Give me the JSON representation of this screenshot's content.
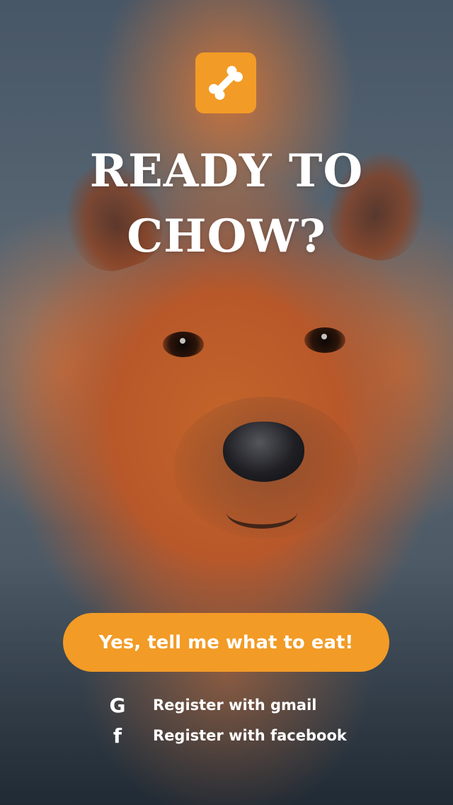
{
  "app": {
    "logo_icon": "bone-icon",
    "accent_color": "#f29b26"
  },
  "hero": {
    "headline_line1": "READY TO",
    "headline_line2": "CHOW?",
    "background": "photo of a chow chow dog looking up"
  },
  "cta": {
    "label": "Yes, tell me what to eat!"
  },
  "register": {
    "gmail": {
      "icon_glyph": "G",
      "icon_name": "google-icon",
      "label": "Register with gmail"
    },
    "facebook": {
      "icon_glyph": "f",
      "icon_name": "facebook-icon",
      "label": "Register with facebook"
    }
  }
}
